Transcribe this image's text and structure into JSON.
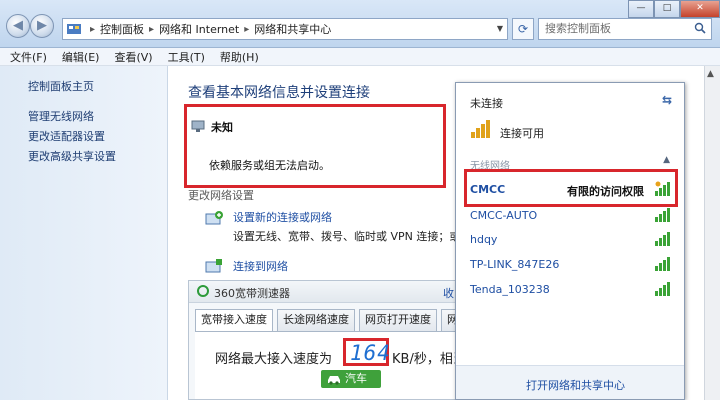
{
  "address_bar": {
    "breadcrumbs": [
      "控制面板",
      "网络和 Internet",
      "网络和共享中心"
    ],
    "search_placeholder": "搜索控制面板"
  },
  "menu": [
    "文件(F)",
    "编辑(E)",
    "查看(V)",
    "工具(T)",
    "帮助(H)"
  ],
  "sidebar": {
    "items": [
      "控制面板主页",
      "管理无线网络",
      "更改适配器设置",
      "更改高级共享设置"
    ]
  },
  "main": {
    "title": "查看基本网络信息并设置连接",
    "network": {
      "name": "未知",
      "description": "依赖服务或组无法启动。"
    },
    "section_label": "更改网络设置",
    "tasks": [
      {
        "link": "设置新的连接或网络",
        "desc": "设置无线、宽带、拨号、临时或 VPN 连接；或设置"
      },
      {
        "link": "连接到网络"
      }
    ]
  },
  "speed_tester": {
    "title": "360宽带测速器",
    "extra": "收",
    "tabs": [
      "宽带接入速度",
      "长途网络速度",
      "网页打开速度",
      "网速排"
    ],
    "label": "网络最大接入速度为",
    "value": "164",
    "unit": "KB/秒，相当",
    "badge": "汽车"
  },
  "wifi_flyout": {
    "status": "未连接",
    "connection": "连接可用",
    "section": "无线网络",
    "networks": [
      {
        "name": "CMCC",
        "status": "有限的访问权限",
        "signal": 1.0,
        "secured": true
      },
      {
        "name": "CMCC-AUTO",
        "signal": 1.0
      },
      {
        "name": "hdqy",
        "signal": 1.0
      },
      {
        "name": "TP-LINK_847E26",
        "signal": 1.0
      },
      {
        "name": "Tenda_103238",
        "signal": 1.0
      }
    ],
    "footer": "打开网络和共享中心"
  },
  "colors": {
    "highlight": "#d8262c",
    "link": "#1f4fa3",
    "title": "#1e3f7a",
    "signal": "#3aa336"
  }
}
